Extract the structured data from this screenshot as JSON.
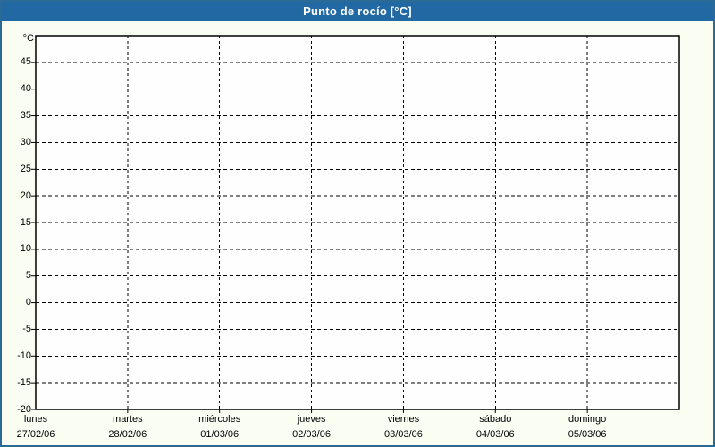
{
  "window": {
    "title": "Punto de rocío [°C]"
  },
  "colors": {
    "title_bar_bg": "#2269A3",
    "title_text": "#FFFFFF",
    "outer_border": "#2B6A94",
    "background": "#FAFDF2",
    "plot_background": "#FEFEFE",
    "grid_line": "#000000",
    "axis_line": "#000000",
    "label_text": "#000000"
  },
  "chart_data": {
    "type": "line",
    "title": "Punto de rocío [°C]",
    "ylabel": "°C",
    "xlabel": "",
    "grid": "dashed",
    "legend": "none",
    "series": [],
    "y_axis": {
      "unit_label": "°C",
      "min": -20,
      "max": 50,
      "tick_step": 5,
      "tick_labels": [
        "45",
        "40",
        "35",
        "30",
        "25",
        "20",
        "15",
        "10",
        "5",
        "0",
        "-5",
        "-10",
        "-15",
        "-20"
      ]
    },
    "x_axis": {
      "days": [
        {
          "name": "lunes",
          "date": "27/02/06"
        },
        {
          "name": "martes",
          "date": "28/02/06"
        },
        {
          "name": "miércoles",
          "date": "01/03/06"
        },
        {
          "name": "jueves",
          "date": "02/03/06"
        },
        {
          "name": "viernes",
          "date": "03/03/06"
        },
        {
          "name": "sábado",
          "date": "04/03/06"
        },
        {
          "name": "domingo",
          "date": "05/03/06"
        }
      ]
    }
  }
}
